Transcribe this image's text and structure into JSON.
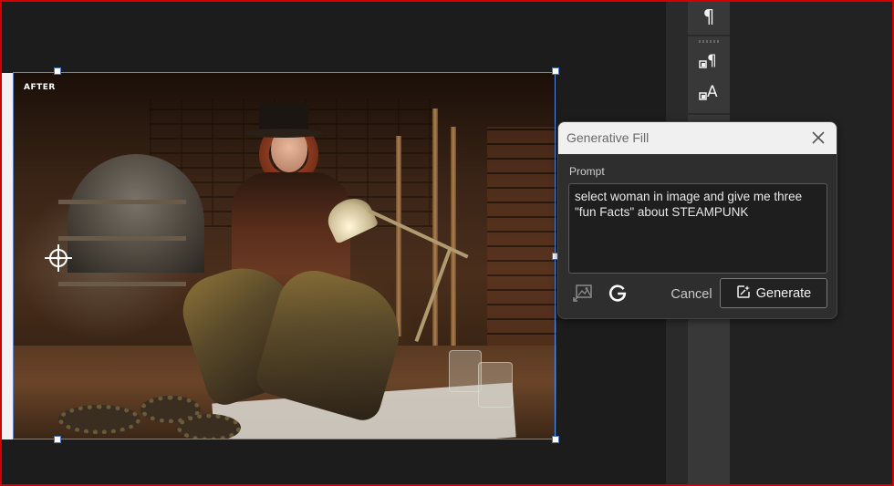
{
  "canvas": {
    "after_label": "AFTER"
  },
  "tools": [
    {
      "icon": "paragraph-icon",
      "glyph": "¶"
    },
    {
      "icon": "paragraph-style-icon",
      "glyph": "¶"
    },
    {
      "icon": "character-style-icon",
      "glyph": "A"
    }
  ],
  "dialog": {
    "title": "Generative Fill",
    "prompt_label": "Prompt",
    "prompt_value": "select woman in image and give me three \"fun Facts\" about STEAMPUNK",
    "cancel_label": "Cancel",
    "generate_label": "Generate"
  },
  "colors": {
    "frame_border": "#d40000",
    "selection": "#5a88d8"
  }
}
